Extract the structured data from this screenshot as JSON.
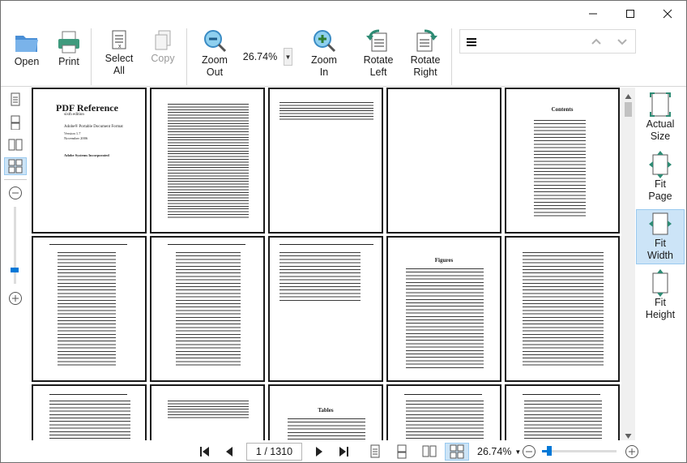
{
  "toolbar": {
    "open": "Open",
    "print": "Print",
    "select_all": "Select\nAll",
    "copy": "Copy",
    "zoom_out": "Zoom\nOut",
    "zoom_value": "26.74%",
    "zoom_in": "Zoom\nIn",
    "rotate_left": "Rotate\nLeft",
    "rotate_right": "Rotate\nRight"
  },
  "search": {
    "value": ""
  },
  "right_panel": {
    "actual_size": "Actual\nSize",
    "fit_page": "Fit\nPage",
    "fit_width": "Fit\nWidth",
    "fit_height": "Fit\nHeight"
  },
  "status": {
    "page_display": "1 / 1310",
    "zoom_value": "26.74%",
    "zoom_slider_level": 0.1
  },
  "pages": {
    "p1_title": "PDF Reference",
    "p1_edition": "sixth edition",
    "p1_subtitle": "Adobe® Portable Document Format",
    "p1_version": "Version 1.7",
    "p1_date": "November 2006",
    "p1_company": "Adobe Systems Incorporated",
    "p5_title": "Contents",
    "p9_title": "Figures",
    "p13_title": "Tables"
  },
  "colors": {
    "accent": "#0078d7",
    "selected_bg": "#cce4f7",
    "icon_teal": "#2e8b74",
    "icon_blue": "#3b8fd9"
  }
}
